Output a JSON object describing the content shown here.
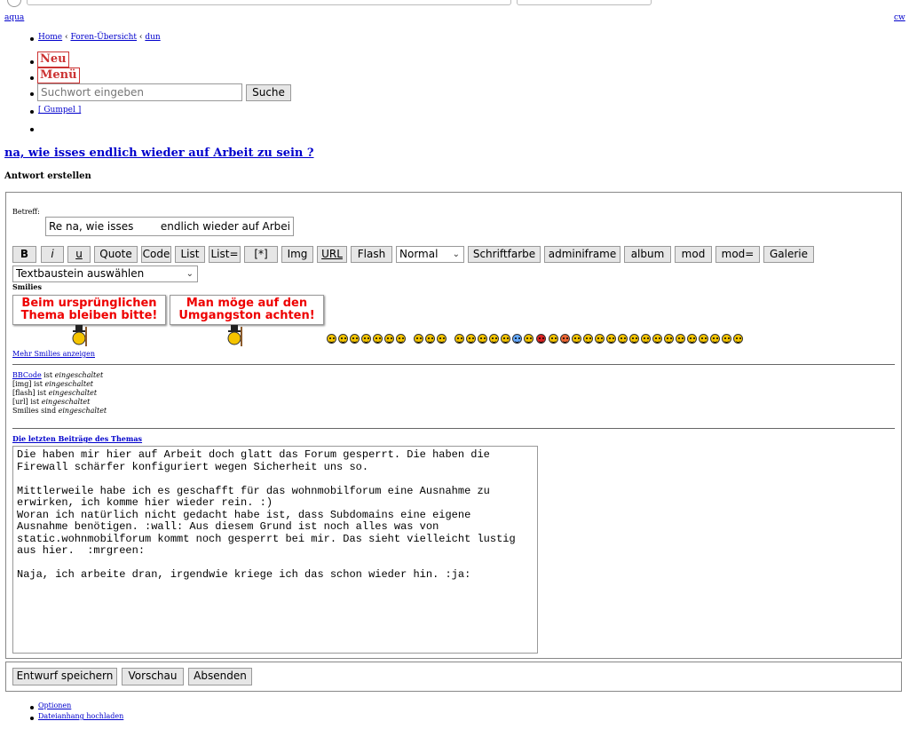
{
  "top_left_link": "aqua",
  "top_right_link": "cw",
  "breadcrumb": {
    "home": "Home",
    "sep1": " ‹ ",
    "forums": "Foren-Übersicht",
    "sep2": " ‹ ",
    "current": "dun"
  },
  "menu": {
    "neu": "Neu",
    "menue": "Menü"
  },
  "search": {
    "placeholder": "Suchwort eingeben",
    "button": "Suche"
  },
  "user_link": "[ Gumpel ]",
  "thread_title": "na, wie isses endlich wieder auf Arbeit zu sein ?",
  "section_heading": "Antwort erstellen",
  "subject": {
    "label": "Betreff:",
    "value": "Re na, wie isses        endlich wieder auf Arbeit zu"
  },
  "toolbar": {
    "bold": "B",
    "italic": "i",
    "underline": "u",
    "quote": "Quote",
    "code": "Code",
    "list": "List",
    "list_eq": "List=",
    "star": "[*]",
    "img": "Img",
    "url": "URL",
    "flash": "Flash",
    "size_select": "Normal",
    "font_color": "Schriftfarbe",
    "adminiframe": "adminiframe",
    "album": "album",
    "mod": "mod",
    "mod_eq": "mod=",
    "gallery": "Galerie"
  },
  "textbaustein_select": "Textbaustein auswählen",
  "smilies": {
    "label": "Smilies",
    "sign1_line1": "Beim ursprünglichen",
    "sign1_line2": "Thema bleiben bitte!",
    "sign2_line1": "Man möge auf den",
    "sign2_line2": "Umgangston achten!",
    "more": "Mehr Smilies anzeigen"
  },
  "status": {
    "bbcode_link": "BBCode",
    "bbcode_text": " ist ",
    "bbcode_state": "eingeschaltet",
    "img_text": "[img] ist ",
    "img_state": "eingeschaltet",
    "flash_text": "[flash] ist ",
    "flash_state": "eingeschaltet",
    "url_text": "[url] ist ",
    "url_state": "eingeschaltet",
    "smilies_text": "Smilies sind ",
    "smilies_state": "eingeschaltet"
  },
  "latest_posts_link": "Die letzten Beiträge des Themas",
  "message": "Die haben mir hier auf Arbeit doch glatt das Forum gesperrt. Die haben die\nFirewall schärfer konfiguriert wegen Sicherheit uns so.\n\nMittlerweile habe ich es geschafft für das wohnmobilforum eine Ausnahme zu\nerwirken, ich komme hier wieder rein. :)\nWoran ich natürlich nicht gedacht habe ist, dass Subdomains eine eigene\nAusnahme benötigen. :wall: Aus diesem Grund ist noch alles was von\nstatic.wohnmobilforum kommt noch gesperrt bei mir. Das sieht vielleicht lustig\naus hier.  :mrgreen:\n\nNaja, ich arbeite dran, irgendwie kriege ich das schon wieder hin. :ja:",
  "actions": {
    "save_draft": "Entwurf speichern",
    "preview": "Vorschau",
    "submit": "Absenden"
  },
  "footer_links": {
    "options": "Optionen",
    "attach": "Dateianhang hochladen"
  }
}
